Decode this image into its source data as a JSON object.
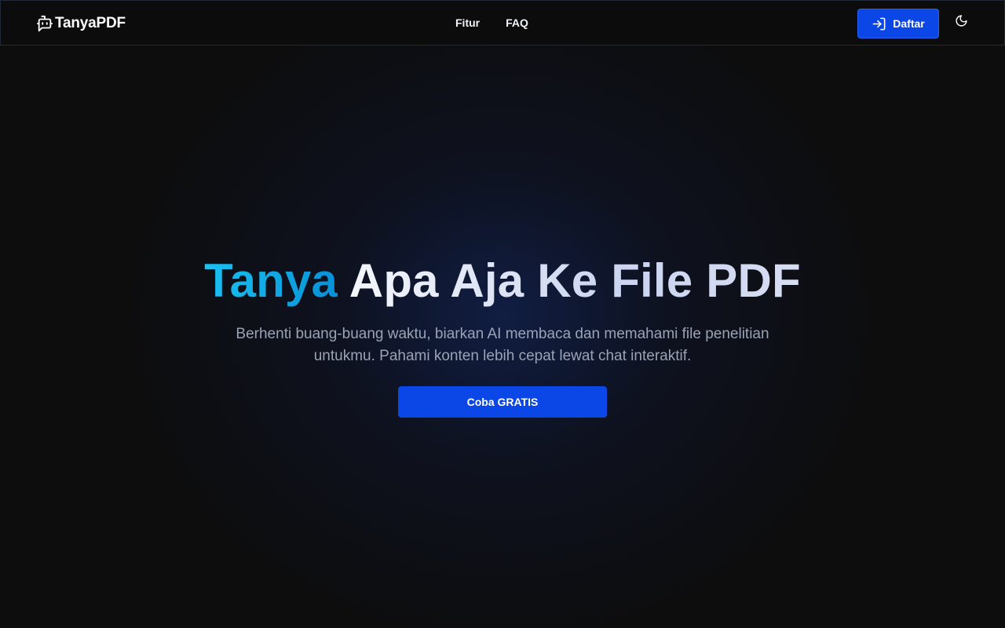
{
  "header": {
    "brand": {
      "name": "TanyaPDF",
      "icon": "chat-bot-icon"
    },
    "nav": [
      {
        "label": "Fitur"
      },
      {
        "label": "FAQ"
      }
    ],
    "signup_button": {
      "label": "Daftar",
      "icon": "login-icon"
    },
    "theme_toggle": {
      "icon": "moon-icon"
    }
  },
  "hero": {
    "title_accent": "Tanya",
    "title_rest": "Apa Aja Ke File PDF",
    "subtitle": "Berhenti buang-buang waktu, biarkan AI membaca dan memahami file penelitian untukmu. Pahami konten lebih cepat lewat chat interaktif.",
    "cta_label": "Coba GRATIS"
  },
  "colors": {
    "background": "#0d0d0e",
    "primary_button": "#0b46e6",
    "title_accent": "#0ea5e9",
    "subtitle": "#9aa3b5"
  }
}
